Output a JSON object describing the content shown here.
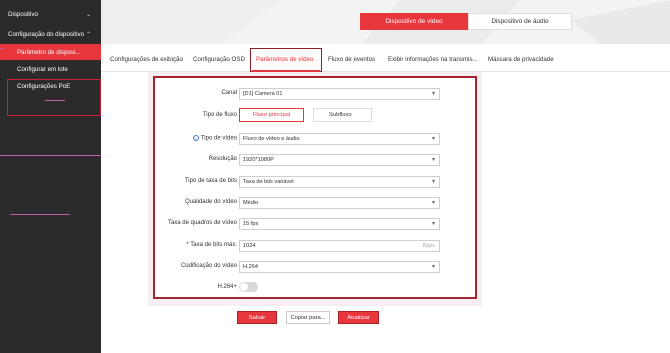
{
  "sidebar": {
    "dispositivo": "Dispositivo",
    "configuracao": "Configuração do dispositivo",
    "items": [
      {
        "label": "Parâmetro de disposi..."
      },
      {
        "label": "Configurar em lote"
      },
      {
        "label": "Configurações PoE"
      }
    ]
  },
  "header": {
    "video_label": "Dispositivo de vídeo",
    "audio_label": "Dispositivo de áudio"
  },
  "tabs": [
    {
      "label": "Configurações de exibição"
    },
    {
      "label": "Configuração OSD"
    },
    {
      "label": "Parâmetros de vídeo"
    },
    {
      "label": "Fluxo de eventos"
    },
    {
      "label": "Exibir informações na transmis..."
    },
    {
      "label": "Máscara de privacidade"
    }
  ],
  "form": {
    "canal": {
      "label": "Canal",
      "value": "[D1] Camera 01"
    },
    "tipo_fluxo": {
      "label": "Tipo de fluxo",
      "main": "Fluxo principal",
      "sub": "Subfluxo"
    },
    "tipo_video": {
      "label": "Tipo de vídeo",
      "value": "Fluxo de vídeo e áudio"
    },
    "resolucao": {
      "label": "Resolução",
      "value": "1920*1080P"
    },
    "taxa_bits_tipo": {
      "label": "Tipo de taxa de bits",
      "value": "Taxa de bits variável"
    },
    "qualidade": {
      "label": "Qualidade do vídeo",
      "value": "Médio"
    },
    "quadros": {
      "label": "Taxa de quadros de vídeo",
      "value": "15 fps"
    },
    "bits_max": {
      "label": "* Taxa de bits máx.",
      "value": "1024",
      "unit": "Kbps"
    },
    "codificacao": {
      "label": "Codificação do vídeo",
      "value": "H.264"
    },
    "h264plus": {
      "label": "H.264+",
      "enabled": false
    }
  },
  "buttons": {
    "salvar": "Salvar",
    "copiar": "Copiar para...",
    "atualizar": "Atualizar"
  },
  "icons": {
    "chevron": "▾",
    "info": "i"
  },
  "colors": {
    "accent": "#e8363d",
    "sidebar": "#2b2b2b",
    "outline": "#a6252c"
  }
}
